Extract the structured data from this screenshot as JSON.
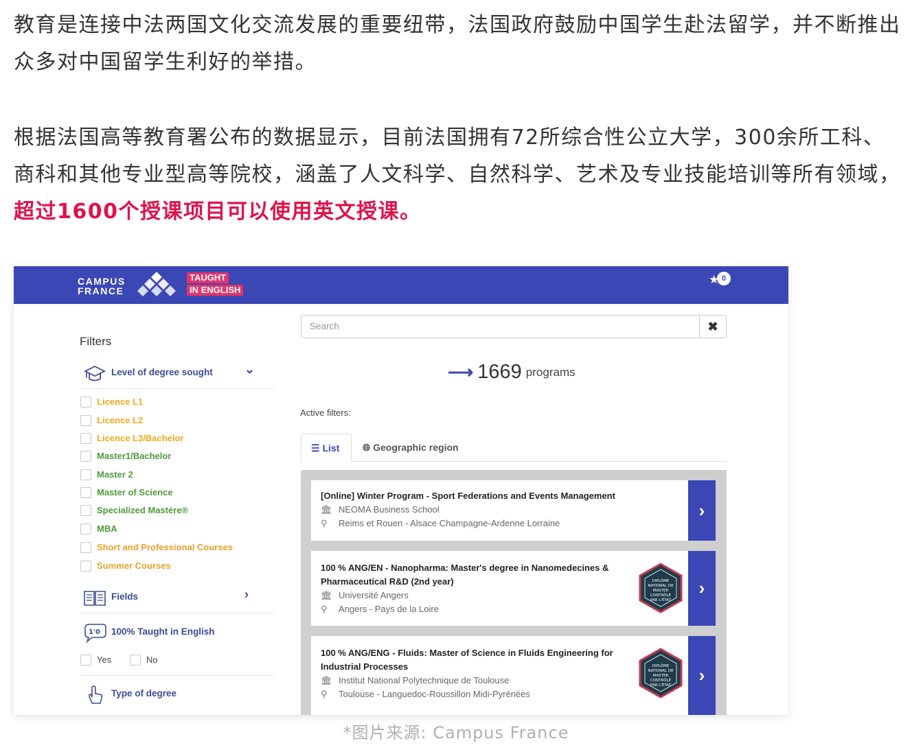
{
  "article": {
    "para1": "教育是连接中法两国文化交流发展的重要纽带，法国政府鼓励中国学生赴法留学，并不断推出众多对中国留学生利好的举措。",
    "para2_plain": "根据法国高等教育署公布的数据显示，目前法国拥有72所综合性公立大学，300余所工科、商科和其他专业型高等院校，涵盖了人文科学、自然科学、艺术及专业技能培训等所有领域，",
    "para2_highlight": "超过1600个授课项目可以使用英文授课。",
    "caption": "*图片来源: Campus France",
    "highlight_color": "#e0124b"
  },
  "site": {
    "logo_line1": "CAMPUS",
    "logo_line2": "FRANCE",
    "tag_line1": "TAUGHT",
    "tag_line2": "IN ENGLISH",
    "cart_count": "0",
    "brand_color": "#3b47b5",
    "tag_color": "#e3336a"
  },
  "filters": {
    "title": "Filters",
    "degree_heading": "Level of degree sought",
    "degree_options": [
      "Licence L1",
      "Licence L2",
      "Licence L3/Bachelor",
      "Master1/Bachelor",
      "Master 2",
      "Master of Science",
      "Specialized Mastère®",
      "MBA",
      "Short and Professional Courses",
      "Summer Courses"
    ],
    "fields_heading": "Fields",
    "taught_heading": "100% Taught in English",
    "yes_label": "Yes",
    "no_label": "No",
    "type_heading": "Type of degree"
  },
  "search": {
    "placeholder": "Search",
    "clear_icon": "close-icon"
  },
  "results": {
    "count": "1669",
    "count_unit": "programs",
    "active_filters_label": "Active filters:",
    "tabs": [
      "List",
      "Geographic region"
    ],
    "programs": [
      {
        "title": "[Online] Winter Program - Sport Federations and Events Management",
        "school": "NEOMA Business School",
        "location": "Reims et Rouen - Alsace Champagne-Ardenne Lorraine",
        "badge": false
      },
      {
        "title": "100 % ANG/EN - Nanopharma: Master's degree in Nanomedecines & Pharmaceutical R&D (2nd year)",
        "school": "Université Angers",
        "location": "Angers - Pays de la Loire",
        "badge": true
      },
      {
        "title": "100 % ANG/ENG - Fluids: Master of Science in Fluids Engineering for Industrial Processes",
        "school": "Institut National Polytechnique de Toulouse",
        "location": "Toulouse - Languedoc-Roussillon Midi-Pyrénées",
        "badge": true
      }
    ],
    "badge_text": [
      "DIPLÔME",
      "NATIONAL DE",
      "MASTER",
      "CONTRÔLÉ",
      "PAR L'ÉTAT"
    ]
  }
}
